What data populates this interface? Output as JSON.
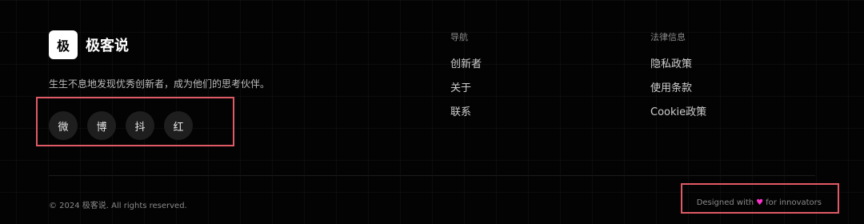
{
  "brand": {
    "logo_char": "极",
    "name": "极客说"
  },
  "tagline": "生生不息地发现优秀创新者，成为他们的思考伙伴。",
  "socials": [
    {
      "label": "微",
      "icon": "weibo-icon"
    },
    {
      "label": "博",
      "icon": "bo-icon"
    },
    {
      "label": "抖",
      "icon": "douyin-icon"
    },
    {
      "label": "红",
      "icon": "xiaohongshu-icon"
    }
  ],
  "nav": {
    "title": "导航",
    "links": [
      "创新者",
      "关于",
      "联系"
    ]
  },
  "legal": {
    "title": "法律信息",
    "links": [
      "隐私政策",
      "使用条款",
      "Cookie政策"
    ]
  },
  "footer": {
    "copyright": "© 2024 极客说. All rights reserved.",
    "credit_prefix": "Designed with",
    "heart": "♥",
    "credit_suffix": "for innovators"
  },
  "colors": {
    "background": "#030303",
    "accent_heart": "#ff33cc",
    "highlight": "#e05a66"
  }
}
